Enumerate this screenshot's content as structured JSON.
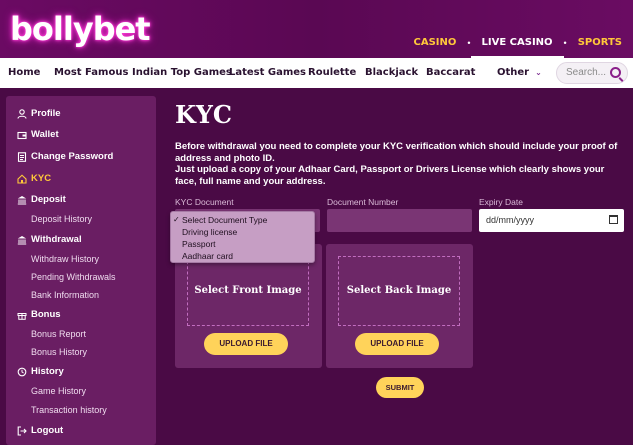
{
  "brand": {
    "logo": "bollybet"
  },
  "topnav": {
    "casino": "CASINO",
    "live_casino": "LIVE CASINO",
    "sports": "SPORTS",
    "separator": "•"
  },
  "catnav": {
    "items": [
      "Home",
      "Most Famous",
      "Indian Top Games",
      "Latest Games",
      "Roulette",
      "Blackjack",
      "Baccarat",
      "Other"
    ],
    "other_chevron": "⌄",
    "search_placeholder": "Search..."
  },
  "sidebar": {
    "profile": "Profile",
    "wallet": "Wallet",
    "change_password": "Change Password",
    "kyc": "KYC",
    "deposit": "Deposit",
    "deposit_history": "Deposit History",
    "withdrawal": "Withdrawal",
    "withdraw_history": "Withdraw History",
    "pending_withdrawals": "Pending Withdrawals",
    "bank_information": "Bank Information",
    "bonus": "Bonus",
    "bonus_report": "Bonus Report",
    "bonus_history": "Bonus History",
    "history": "History",
    "game_history": "Game History",
    "transaction_history": "Transaction history",
    "logout": "Logout"
  },
  "main": {
    "title": "KYC",
    "desc_line1": "Before withdrawal you need to complete your KYC verification which should include your proof of address and photo ID.",
    "desc_line2": "Just upload a copy of your Adhaar Card, Passport or Drivers License which clearly shows your face, full name and your address.",
    "kyc_document_label": "KYC Document",
    "document_number_label": "Document Number",
    "expiry_date_label": "Expiry Date",
    "expiry_date_value": "dd/mm/yyyy",
    "dropdown_options": [
      "Select Document Type",
      "Driving license",
      "Passport",
      "Aadhaar card"
    ],
    "front_image": "Select Front Image",
    "back_image": "Select Back Image",
    "upload_front": "UPLOAD FILE",
    "upload_back": "UPLOAD FILE",
    "submit": "SUBMIT"
  },
  "colors": {
    "accent": "#ffc83a",
    "button": "#ffd35a",
    "background": "#4a0a45",
    "sidebar": "#6a1e63"
  }
}
